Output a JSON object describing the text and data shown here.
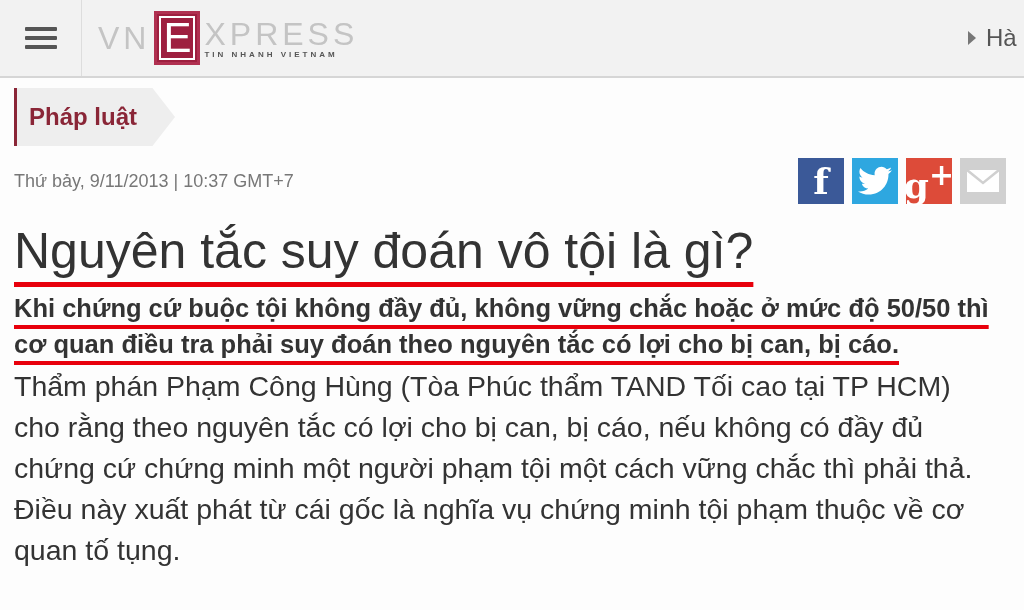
{
  "header": {
    "logo": {
      "left": "VN",
      "mark": "E",
      "right": "XPRESS",
      "tagline": "TIN NHANH VIETNAM"
    },
    "location": "Hà"
  },
  "category": "Pháp luật",
  "dateline": "Thứ bảy, 9/11/2013 | 10:37 GMT+7",
  "share_buttons": [
    {
      "kind": "facebook",
      "label": "f"
    },
    {
      "kind": "twitter"
    },
    {
      "kind": "googleplus",
      "label": "g$^{+}$"
    },
    {
      "kind": "email"
    }
  ],
  "title": "Nguyên tắc suy đoán vô tội là gì?",
  "lead": "Khi chứng cứ buộc tội không đầy đủ, không vững chắc hoặc ở mức độ 50/50 thì cơ quan điều tra phải suy đoán theo nguyên tắc có lợi cho bị can, bị cáo.",
  "body": "Thẩm phán Phạm Công Hùng (Tòa Phúc thẩm TAND Tối cao tại TP HCM) cho rằng theo nguyên tắc có lợi cho bị can, bị cáo, nếu không có đầy đủ chứng cứ chứng minh một người phạm tội một cách vững chắc thì phải thả. Điều này xuất phát từ cái gốc là nghĩa vụ chứng minh tội phạm thuộc về cơ quan tố tụng."
}
